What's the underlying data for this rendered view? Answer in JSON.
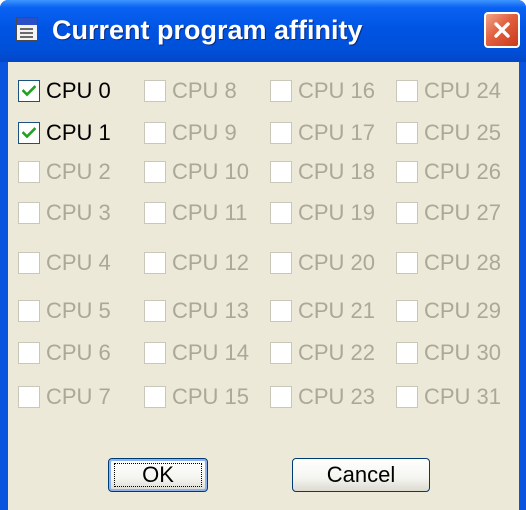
{
  "window": {
    "title": "Current program affinity"
  },
  "icons": {
    "title_icon": "document-icon",
    "close_icon": "close-icon",
    "check_icon": "checkmark-icon"
  },
  "colors": {
    "titlebar": "#0054e3",
    "close": "#e25f3e",
    "dialog_bg": "#ece9d8",
    "disabled_text": "#aca899",
    "check": "#21a121"
  },
  "cpus": [
    {
      "label": "CPU 0",
      "checked": true,
      "enabled": true
    },
    {
      "label": "CPU 1",
      "checked": true,
      "enabled": true
    },
    {
      "label": "CPU 2",
      "checked": false,
      "enabled": false
    },
    {
      "label": "CPU 3",
      "checked": false,
      "enabled": false
    },
    {
      "label": "CPU 4",
      "checked": false,
      "enabled": false
    },
    {
      "label": "CPU 5",
      "checked": false,
      "enabled": false
    },
    {
      "label": "CPU 6",
      "checked": false,
      "enabled": false
    },
    {
      "label": "CPU 7",
      "checked": false,
      "enabled": false
    },
    {
      "label": "CPU 8",
      "checked": false,
      "enabled": false
    },
    {
      "label": "CPU 9",
      "checked": false,
      "enabled": false
    },
    {
      "label": "CPU 10",
      "checked": false,
      "enabled": false
    },
    {
      "label": "CPU 11",
      "checked": false,
      "enabled": false
    },
    {
      "label": "CPU 12",
      "checked": false,
      "enabled": false
    },
    {
      "label": "CPU 13",
      "checked": false,
      "enabled": false
    },
    {
      "label": "CPU 14",
      "checked": false,
      "enabled": false
    },
    {
      "label": "CPU 15",
      "checked": false,
      "enabled": false
    },
    {
      "label": "CPU 16",
      "checked": false,
      "enabled": false
    },
    {
      "label": "CPU 17",
      "checked": false,
      "enabled": false
    },
    {
      "label": "CPU 18",
      "checked": false,
      "enabled": false
    },
    {
      "label": "CPU 19",
      "checked": false,
      "enabled": false
    },
    {
      "label": "CPU 20",
      "checked": false,
      "enabled": false
    },
    {
      "label": "CPU 21",
      "checked": false,
      "enabled": false
    },
    {
      "label": "CPU 22",
      "checked": false,
      "enabled": false
    },
    {
      "label": "CPU 23",
      "checked": false,
      "enabled": false
    },
    {
      "label": "CPU 24",
      "checked": false,
      "enabled": false
    },
    {
      "label": "CPU 25",
      "checked": false,
      "enabled": false
    },
    {
      "label": "CPU 26",
      "checked": false,
      "enabled": false
    },
    {
      "label": "CPU 27",
      "checked": false,
      "enabled": false
    },
    {
      "label": "CPU 28",
      "checked": false,
      "enabled": false
    },
    {
      "label": "CPU 29",
      "checked": false,
      "enabled": false
    },
    {
      "label": "CPU 30",
      "checked": false,
      "enabled": false
    },
    {
      "label": "CPU 31",
      "checked": false,
      "enabled": false
    }
  ],
  "buttons": {
    "ok": "OK",
    "cancel": "Cancel"
  }
}
